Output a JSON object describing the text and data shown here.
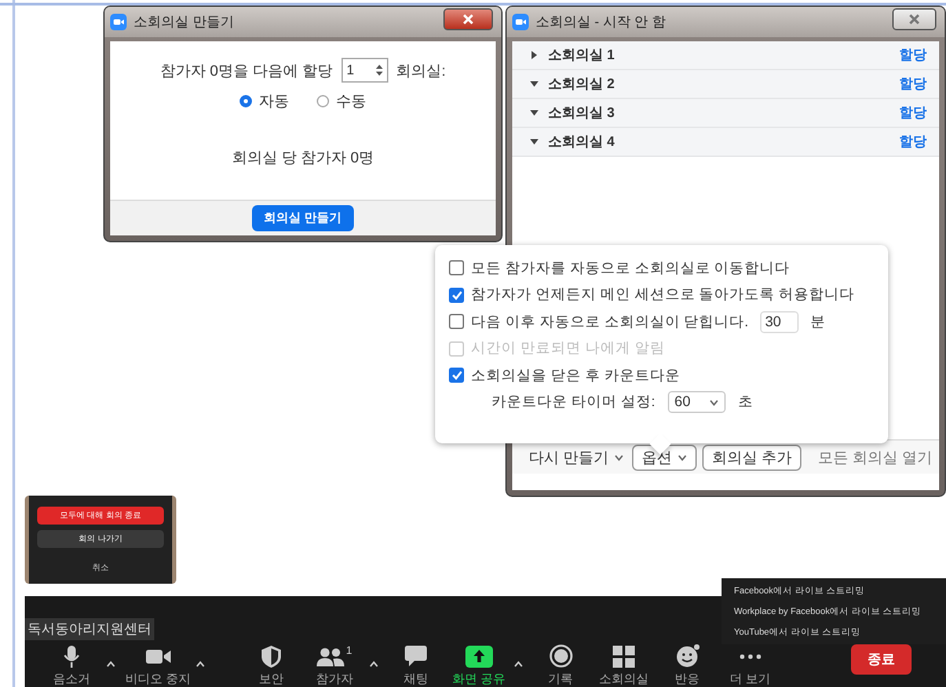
{
  "create_dialog": {
    "title": "소회의실 만들기",
    "assign_prefix": "참가자 0명을 다음에 할당",
    "room_count": "1",
    "assign_suffix": "회의실:",
    "modes": [
      {
        "label": "자동",
        "selected": true
      },
      {
        "label": "수동",
        "selected": false
      }
    ],
    "per_room": "회의실 당 참가자 0명",
    "create_button": "회의실 만들기"
  },
  "rooms_window": {
    "title": "소회의실 - 시작 안 함",
    "rooms": [
      {
        "name": "소회의실 1",
        "expanded": false,
        "action": "할당"
      },
      {
        "name": "소회의실 2",
        "expanded": true,
        "action": "할당"
      },
      {
        "name": "소회의실 3",
        "expanded": true,
        "action": "할당"
      },
      {
        "name": "소회의실 4",
        "expanded": true,
        "action": "할당"
      }
    ],
    "footer": {
      "recreate": "다시 만들기",
      "options": "옵션",
      "add_room": "회의실 추가",
      "open_all": "모든 회의실 열기"
    }
  },
  "options_popover": {
    "items": [
      {
        "kind": "checkbox",
        "label": "모든 참가자를 자동으로 소회의실로 이동합니다",
        "checked": false,
        "disabled": false
      },
      {
        "kind": "checkbox",
        "label": "참가자가 언제든지 메인 세션으로 돌아가도록 허용합니다",
        "checked": true,
        "disabled": false
      },
      {
        "kind": "checkbox_number",
        "label": "다음 이후 자동으로 소회의실이 닫힙니다.",
        "checked": false,
        "disabled": false,
        "value": "30",
        "unit": "분"
      },
      {
        "kind": "checkbox",
        "label": "시간이 만료되면 나에게 알림",
        "checked": false,
        "disabled": true
      },
      {
        "kind": "checkbox",
        "label": "소회의실을 닫은 후 카운트다운",
        "checked": true,
        "disabled": false
      },
      {
        "kind": "select",
        "label": "카운트다운 타이머 설정:",
        "value": "60",
        "unit": "초"
      }
    ]
  },
  "end_popup": {
    "buttons": [
      {
        "label": "모두에 대해 회의 종료",
        "kind": "danger"
      },
      {
        "label": "회의 나가기",
        "kind": "secondary"
      },
      {
        "label": "취소",
        "kind": "plain"
      }
    ]
  },
  "toolbar": {
    "meeting_name": "독서동아리지원센터",
    "buttons": [
      {
        "label": "음소거",
        "caret": true
      },
      {
        "label": "비디오 중지",
        "caret": true
      },
      {
        "label": "보안",
        "caret": false
      },
      {
        "label": "참가자",
        "caret": true,
        "count": "1"
      },
      {
        "label": "채팅",
        "caret": false
      },
      {
        "label": "화면 공유",
        "caret": true
      },
      {
        "label": "기록",
        "caret": false
      },
      {
        "label": "소회의실",
        "caret": false
      },
      {
        "label": "반응",
        "caret": false
      },
      {
        "label": "더 보기",
        "caret": false
      }
    ],
    "end_button": "종료"
  },
  "more_menu": {
    "items": [
      "Facebook에서 라이브 스트리밍",
      "Workplace by Facebook에서 라이브 스트리밍",
      "YouTube에서 라이브 스트리밍"
    ]
  }
}
